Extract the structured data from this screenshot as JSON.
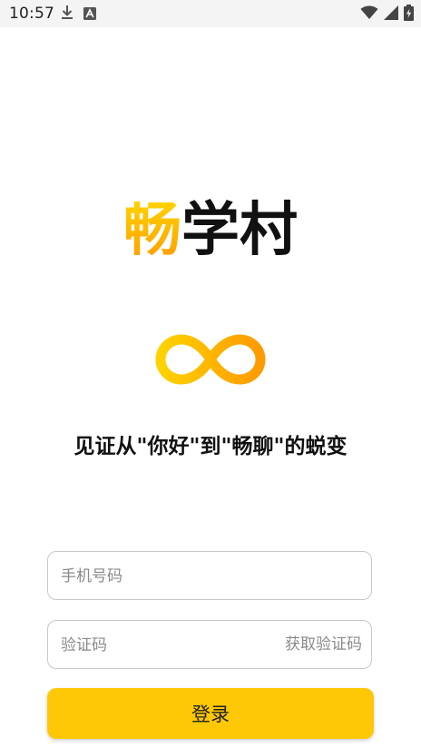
{
  "status_bar": {
    "time": "10:57",
    "icons": [
      "download-icon",
      "font-icon",
      "wifi-icon",
      "signal-icon",
      "battery-icon"
    ]
  },
  "brand": {
    "first_char": "畅",
    "rest": "学村"
  },
  "logo": {
    "icon": "infinity-icon",
    "gradient_start": "#ffd200",
    "gradient_end": "#ff9f00"
  },
  "tagline": "见证从\"你好\"到\"畅聊\"的蜕变",
  "form": {
    "phone_placeholder": "手机号码",
    "code_placeholder": "验证码",
    "get_code_label": "获取验证码",
    "login_label": "登录"
  },
  "colors": {
    "accent": "#ffc806",
    "text": "#111111",
    "placeholder": "#8a8a8a"
  }
}
